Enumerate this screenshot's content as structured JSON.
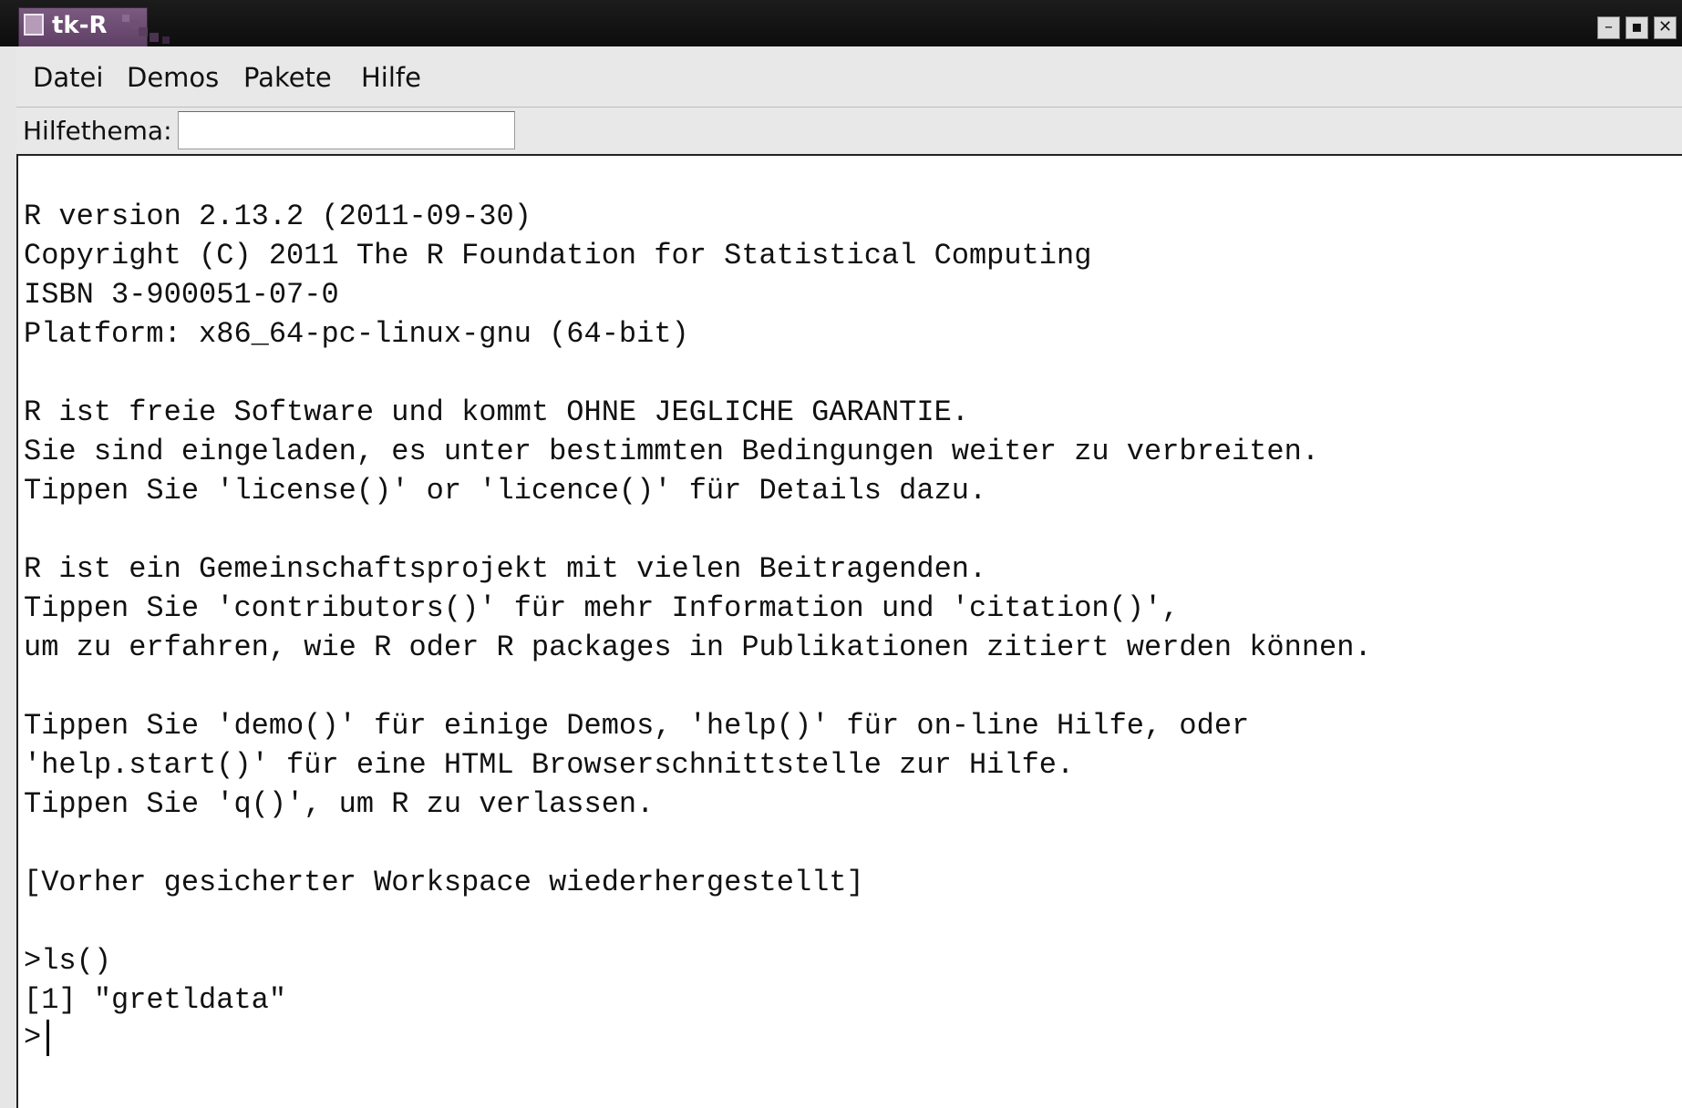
{
  "window": {
    "title": "tk-R",
    "buttons": {
      "minimize": "–",
      "maximize": "▪",
      "close": "✕"
    }
  },
  "menubar": {
    "items": [
      {
        "label": "Datei"
      },
      {
        "label": "Demos"
      },
      {
        "label": "Pakete"
      },
      {
        "label": "Hilfe"
      }
    ]
  },
  "helpbar": {
    "label": "Hilfethema:",
    "input_value": ""
  },
  "console": {
    "lines": [
      "R version 2.13.2 (2011-09-30)",
      "Copyright (C) 2011 The R Foundation for Statistical Computing",
      "ISBN 3-900051-07-0",
      "Platform: x86_64-pc-linux-gnu (64-bit)",
      "",
      "R ist freie Software und kommt OHNE JEGLICHE GARANTIE.",
      "Sie sind eingeladen, es unter bestimmten Bedingungen weiter zu verbreiten.",
      "Tippen Sie 'license()' or 'licence()' für Details dazu.",
      "",
      "R ist ein Gemeinschaftsprojekt mit vielen Beitragenden.",
      "Tippen Sie 'contributors()' für mehr Information und 'citation()',",
      "um zu erfahren, wie R oder R packages in Publikationen zitiert werden können.",
      "",
      "Tippen Sie 'demo()' für einige Demos, 'help()' für on-line Hilfe, oder",
      "'help.start()' für eine HTML Browserschnittstelle zur Hilfe.",
      "Tippen Sie 'q()', um R zu verlassen.",
      "",
      "[Vorher gesicherter Workspace wiederhergestellt]",
      "",
      ">ls()",
      "[1] \"gretldata\""
    ],
    "prompt": ">"
  },
  "colors": {
    "titlebar_bg": "#111111",
    "title_tab": "#6b4b70",
    "menubar_bg": "#e8e8e8",
    "console_bg": "#ffffff",
    "text": "#111111"
  },
  "icons": {
    "window_icon": "window-icon",
    "minimize": "minimize-icon",
    "maximize": "maximize-icon",
    "close": "close-icon"
  }
}
